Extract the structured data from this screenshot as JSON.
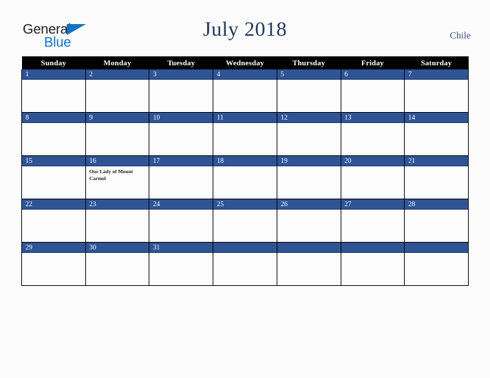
{
  "brand": {
    "word1": "General",
    "word2": "Blue",
    "triangle_icon": "triangle-icon",
    "accent_blue": "#1273c4",
    "dark": "#231f20"
  },
  "header": {
    "title": "July 2018",
    "country": "Chile",
    "title_color": "#23395d"
  },
  "calendar": {
    "month": "July",
    "year": "2018",
    "weekday_headers": [
      "Sunday",
      "Monday",
      "Tuesday",
      "Wednesday",
      "Thursday",
      "Friday",
      "Saturday"
    ],
    "header_bg": "#000000",
    "daynum_bg": "#2f5496",
    "weeks": [
      [
        {
          "day": "1",
          "events": []
        },
        {
          "day": "2",
          "events": []
        },
        {
          "day": "3",
          "events": []
        },
        {
          "day": "4",
          "events": []
        },
        {
          "day": "5",
          "events": []
        },
        {
          "day": "6",
          "events": []
        },
        {
          "day": "7",
          "events": []
        }
      ],
      [
        {
          "day": "8",
          "events": []
        },
        {
          "day": "9",
          "events": []
        },
        {
          "day": "10",
          "events": []
        },
        {
          "day": "11",
          "events": []
        },
        {
          "day": "12",
          "events": []
        },
        {
          "day": "13",
          "events": []
        },
        {
          "day": "14",
          "events": []
        }
      ],
      [
        {
          "day": "15",
          "events": []
        },
        {
          "day": "16",
          "events": [
            "Our Lady of Mount Carmel"
          ]
        },
        {
          "day": "17",
          "events": []
        },
        {
          "day": "18",
          "events": []
        },
        {
          "day": "19",
          "events": []
        },
        {
          "day": "20",
          "events": []
        },
        {
          "day": "21",
          "events": []
        }
      ],
      [
        {
          "day": "22",
          "events": []
        },
        {
          "day": "23",
          "events": []
        },
        {
          "day": "24",
          "events": []
        },
        {
          "day": "25",
          "events": []
        },
        {
          "day": "26",
          "events": []
        },
        {
          "day": "27",
          "events": []
        },
        {
          "day": "28",
          "events": []
        }
      ],
      [
        {
          "day": "29",
          "events": []
        },
        {
          "day": "30",
          "events": []
        },
        {
          "day": "31",
          "events": []
        },
        {
          "day": "",
          "events": []
        },
        {
          "day": "",
          "events": []
        },
        {
          "day": "",
          "events": []
        },
        {
          "day": "",
          "events": []
        }
      ]
    ]
  }
}
